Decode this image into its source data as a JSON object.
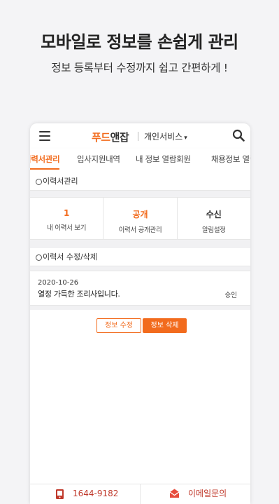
{
  "promo": {
    "title": "모바일로 정보를 손쉽게 관리",
    "subtitle": "정보 등록부터 수정까지 쉽고 간편하게 !"
  },
  "header": {
    "logo_brand": "푸드",
    "logo_name": "앤잡",
    "service_menu": "개인서비스",
    "caret": "▾"
  },
  "tabs": [
    {
      "label": "이력서관리",
      "active": true
    },
    {
      "label": "입사지원내역",
      "active": false
    },
    {
      "label": "내 정보 열람회원",
      "active": false
    },
    {
      "label": "채용정보 열람내역",
      "active": false
    }
  ],
  "resume_manage": {
    "heading": "이력서관리",
    "stats": [
      {
        "value": "1",
        "label": "내 이력서 보기"
      },
      {
        "value": "공개",
        "label": "이력서 공개관리"
      },
      {
        "value": "수신",
        "label": "알림설정"
      }
    ]
  },
  "resume_edit": {
    "heading": "이력서 수정/삭제",
    "item": {
      "date": "2020-10-26",
      "title": "열정 가득한 조리사입니다.",
      "status": "승인"
    },
    "edit_button": "정보 수정",
    "delete_button": "정보 삭제"
  },
  "footer": {
    "phone": "1644-9182",
    "email_inquiry": "이메일문의"
  },
  "colors": {
    "accent": "#f26b1d",
    "footer_text": "#c0392b",
    "background": "#f4f4f6"
  }
}
